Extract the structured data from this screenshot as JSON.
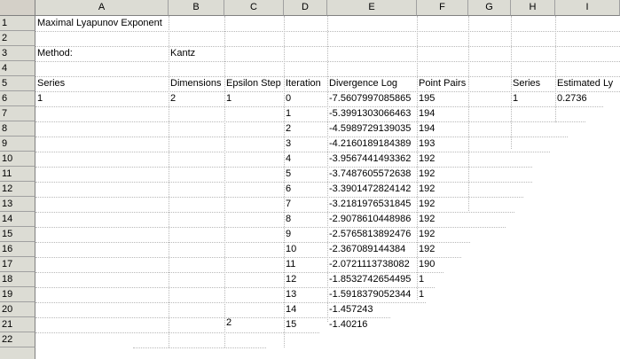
{
  "columns": [
    "A",
    "B",
    "C",
    "D",
    "E",
    "F",
    "G",
    "H",
    "I"
  ],
  "rows": [
    "1",
    "2",
    "3",
    "4",
    "5",
    "6",
    "7",
    "8",
    "9",
    "10",
    "11",
    "12",
    "13",
    "14",
    "15",
    "16",
    "17",
    "18",
    "19",
    "20",
    "21",
    "22"
  ],
  "sheet": {
    "title": "Maximal Lyapunov Exponent",
    "method_label": "Method:",
    "method_value": "Kantz",
    "headers": {
      "series": "Series",
      "dimensions": "Dimensions",
      "epsilon_step": "Epsilon Step",
      "iteration": "Iteration",
      "divergence_log": "Divergence Log",
      "point_pairs": "Point Pairs",
      "series2": "Series",
      "estimated": "Estimated Ly"
    },
    "first_row": {
      "series": "1",
      "dimensions": "2",
      "epsilon_step": "1",
      "series2": "1",
      "estimated": "0.2736"
    },
    "iterations": [
      "0",
      "1",
      "2",
      "3",
      "4",
      "5",
      "6",
      "7",
      "8",
      "9",
      "10",
      "11",
      "12",
      "13",
      "14",
      "15"
    ],
    "divergence": [
      "-7.5607997085865",
      "-5.3991303066463",
      "-4.5989729139035",
      "-4.2160189184389",
      "-3.9567441493362",
      "-3.7487605572638",
      "-3.3901472824142",
      "-3.2181976531845",
      "-2.9078610448986",
      "-2.5765813892476",
      "-2.367089144384",
      "-2.0721113738082",
      "-1.8532742654495",
      "-1.5918379052344",
      "-1.457243",
      "-1.40216"
    ],
    "point_pairs": [
      "195",
      "194",
      "194",
      "193",
      "192",
      "192",
      "192",
      "192",
      "192",
      "192",
      "192",
      "190",
      "1",
      "1",
      "",
      ""
    ],
    "row22_epsilon": "2"
  }
}
